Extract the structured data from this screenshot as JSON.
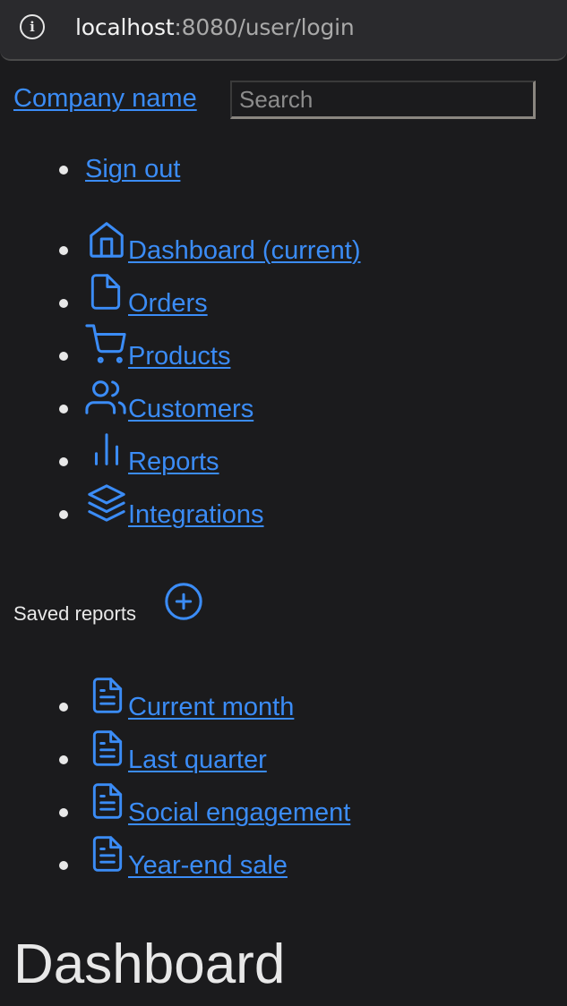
{
  "browser": {
    "host": "localhost",
    "path": ":8080/user/login"
  },
  "header": {
    "brand": "Company name",
    "search_placeholder": "Search"
  },
  "account": {
    "sign_out": "Sign out"
  },
  "nav": {
    "items": [
      {
        "label": " Dashboard (current)",
        "icon": "home-icon"
      },
      {
        "label": " Orders",
        "icon": "file-icon"
      },
      {
        "label": " Products",
        "icon": "shopping-cart-icon"
      },
      {
        "label": " Customers",
        "icon": "users-icon"
      },
      {
        "label": " Reports",
        "icon": "bar-chart-icon"
      },
      {
        "label": " Integrations",
        "icon": "layers-icon"
      }
    ]
  },
  "saved_reports": {
    "heading": "Saved reports",
    "add_icon": "plus-circle-icon",
    "items": [
      {
        "label": " Current month",
        "icon": "file-text-icon"
      },
      {
        "label": " Last quarter",
        "icon": "file-text-icon"
      },
      {
        "label": " Social engagement",
        "icon": "file-text-icon"
      },
      {
        "label": " Year-end sale",
        "icon": "file-text-icon"
      }
    ]
  },
  "main": {
    "title": "Dashboard"
  },
  "colors": {
    "background": "#1b1b1d",
    "link": "#3b8cf6",
    "text": "#e8e8e8"
  }
}
